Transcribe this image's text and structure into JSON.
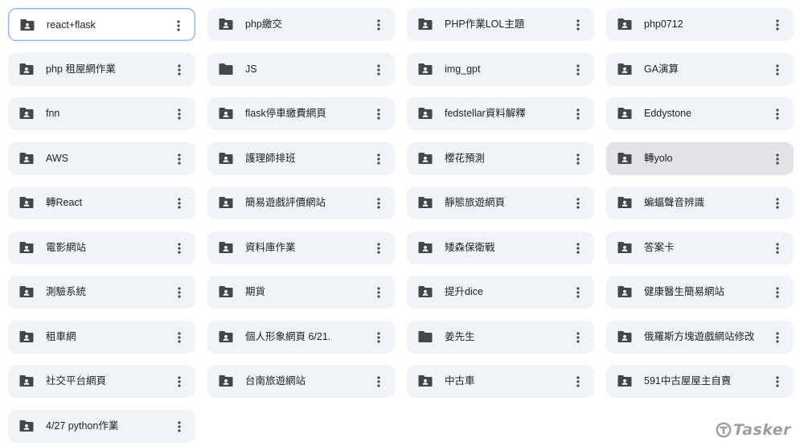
{
  "folders": [
    {
      "name": "react+flask",
      "icon": "shared-folder-icon",
      "state": "selected"
    },
    {
      "name": "php繳交",
      "icon": "shared-folder-icon"
    },
    {
      "name": "PHP作業LOL主題",
      "icon": "shared-folder-icon"
    },
    {
      "name": "php0712",
      "icon": "shared-folder-icon"
    },
    {
      "name": "php 租屋網作業",
      "icon": "shared-folder-icon"
    },
    {
      "name": "JS",
      "icon": "folder-icon"
    },
    {
      "name": "img_gpt",
      "icon": "shared-folder-icon"
    },
    {
      "name": "GA演算",
      "icon": "shared-folder-icon"
    },
    {
      "name": "fnn",
      "icon": "shared-folder-icon"
    },
    {
      "name": "flask停車繳費網頁",
      "icon": "shared-folder-icon"
    },
    {
      "name": "fedstellar資料解釋",
      "icon": "shared-folder-icon"
    },
    {
      "name": "Eddystone",
      "icon": "shared-folder-icon"
    },
    {
      "name": "AWS",
      "icon": "shared-folder-icon"
    },
    {
      "name": "護理師排班",
      "icon": "shared-folder-icon"
    },
    {
      "name": "櫻花預測",
      "icon": "shared-folder-icon"
    },
    {
      "name": "轉yolo",
      "icon": "shared-folder-icon",
      "state": "hover"
    },
    {
      "name": "轉React",
      "icon": "shared-folder-icon"
    },
    {
      "name": "簡易遊戲評價網站",
      "icon": "shared-folder-icon"
    },
    {
      "name": "靜態旅遊網頁",
      "icon": "shared-folder-icon"
    },
    {
      "name": "蝙蝠聲音辨識",
      "icon": "shared-folder-icon"
    },
    {
      "name": "電影網站",
      "icon": "shared-folder-icon"
    },
    {
      "name": "資料庫作業",
      "icon": "shared-folder-icon"
    },
    {
      "name": "矮森保衛戰",
      "icon": "shared-folder-icon"
    },
    {
      "name": "答案卡",
      "icon": "shared-folder-icon"
    },
    {
      "name": "測驗系統",
      "icon": "shared-folder-icon"
    },
    {
      "name": "期貨",
      "icon": "shared-folder-icon"
    },
    {
      "name": "提升dice",
      "icon": "shared-folder-icon"
    },
    {
      "name": "健康醫生簡易網站",
      "icon": "shared-folder-icon"
    },
    {
      "name": "租車網",
      "icon": "shared-folder-icon"
    },
    {
      "name": "個人形象網頁 6/21.",
      "icon": "shared-folder-icon"
    },
    {
      "name": "姜先生",
      "icon": "folder-icon"
    },
    {
      "name": "俄羅斯方塊遊戲網站修改",
      "icon": "shared-folder-icon"
    },
    {
      "name": "社交平台網頁",
      "icon": "shared-folder-icon"
    },
    {
      "name": "台南旅遊網站",
      "icon": "shared-folder-icon"
    },
    {
      "name": "中古車",
      "icon": "shared-folder-icon"
    },
    {
      "name": "591中古屋屋主自賣",
      "icon": "shared-folder-icon"
    },
    {
      "name": "4/27 python作業",
      "icon": "shared-folder-icon"
    }
  ],
  "more_actions_icon": "more-vert-icon",
  "colors": {
    "card_background": "#f0f4f9",
    "card_hover_background": "#e1e3e6",
    "selected_border": "#8ab4f8",
    "icon": "#444746",
    "text": "#1f1f1f"
  },
  "watermark": {
    "text": "Tasker",
    "icon": "tasker-logo-icon"
  }
}
